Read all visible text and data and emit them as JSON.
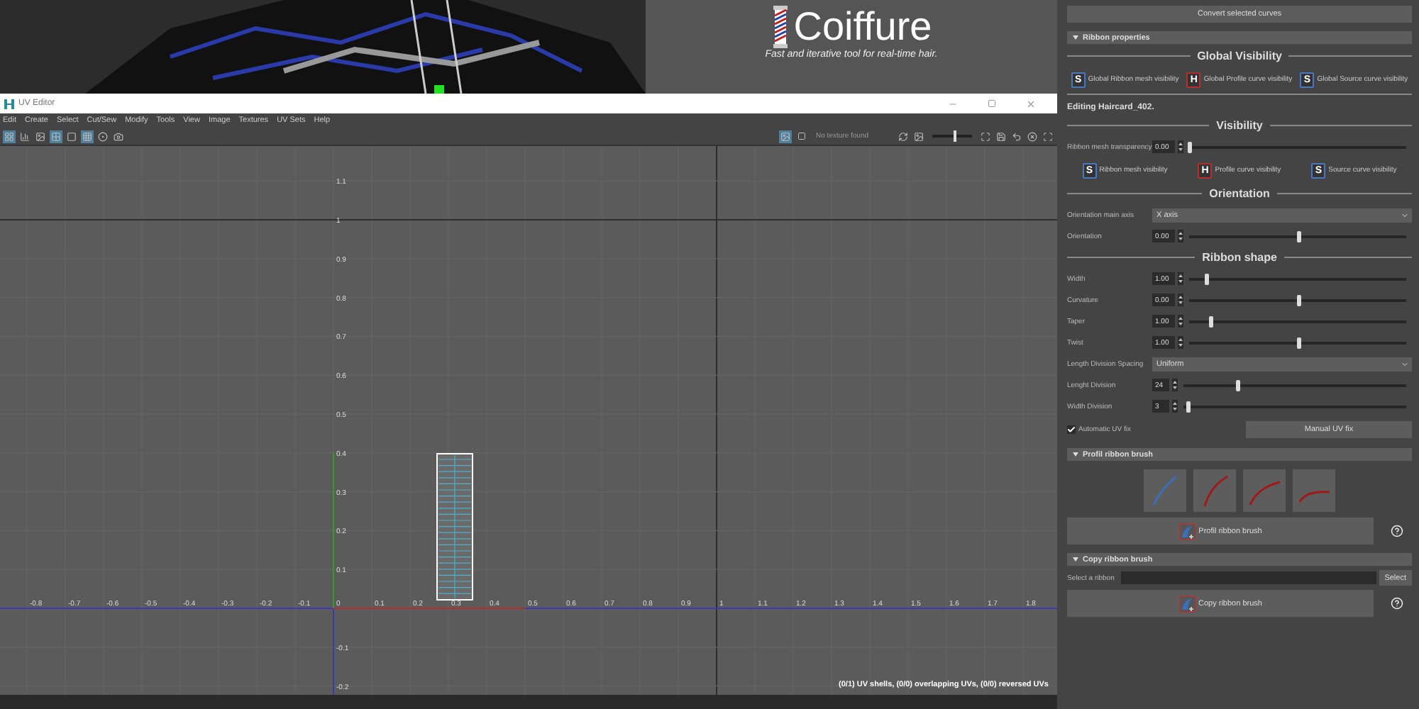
{
  "viewport": {
    "logo": {
      "name": "Coiffure",
      "tagline": "Fast and iterative tool for real-time hair."
    }
  },
  "uv_editor": {
    "title": "UV Editor",
    "menu": [
      "Edit",
      "Create",
      "Select",
      "Cut/Sew",
      "Modify",
      "Tools",
      "View",
      "Image",
      "Textures",
      "UV Sets",
      "Help"
    ],
    "toolbar_left": [
      {
        "selected": true
      },
      {
        "selected": false
      },
      {
        "selected": false
      },
      {
        "selected": true
      },
      {
        "selected": false
      },
      {
        "selected": true
      },
      {
        "selected": false
      },
      {
        "selected": false
      }
    ],
    "toolbar_right": {
      "texture_toggle": {
        "selected": true
      },
      "texture_status": "No texture found",
      "exposure": {
        "level": 0.55
      }
    },
    "x_ticks_negative": [
      "-0.8",
      "-0.7",
      "-0.6",
      "-0.5",
      "-0.4",
      "-0.3",
      "-0.2",
      "-0.1"
    ],
    "x_ticks": [
      "0",
      "0.1",
      "0.2",
      "0.3",
      "0.4",
      "0.5",
      "0.6",
      "0.7",
      "0.8",
      "0.9",
      "1",
      "1.1",
      "1.2",
      "1.3",
      "1.4",
      "1.5",
      "1.6",
      "1.7",
      "1.8"
    ],
    "y_ticks_positive": [
      "1.1",
      "1",
      "0.9",
      "0.8",
      "0.7",
      "0.6",
      "0.5",
      "0.4",
      "0.3",
      "0.2",
      "0.1"
    ],
    "y_ticks_negative": [
      "-0.1",
      "-0.2"
    ],
    "status": "(0/1) UV shells, (0/0) overlapping UVs, (0/0) reversed UVs"
  },
  "panel": {
    "convert_button": "Convert selected curves",
    "ribbon_properties": {
      "header": "Ribbon properties",
      "expanded": true,
      "global_visibility": {
        "title": "Global Visibility",
        "toggles": [
          {
            "letter": "S",
            "label": "Global Ribbon mesh visibility",
            "color": "#4a78c0"
          },
          {
            "letter": "H",
            "label": "Global Profile curve visibility",
            "color": "#b03030"
          },
          {
            "letter": "S",
            "label": "Global Source curve visibility",
            "color": "#4a78c0"
          }
        ]
      },
      "editing": "Editing Haircard_402.",
      "visibility": {
        "title": "Visibility",
        "transparency": {
          "label": "Ribbon mesh transparency",
          "value": "0.00",
          "level": 0
        },
        "toggles": [
          {
            "letter": "S",
            "label": "Ribbon mesh visibility",
            "color": "#4a78c0"
          },
          {
            "letter": "H",
            "label": "Profile curve visibility",
            "color": "#b03030"
          },
          {
            "letter": "S",
            "label": "Source curve visibility",
            "color": "#4a78c0"
          }
        ]
      },
      "orientation": {
        "title": "Orientation",
        "main_axis": {
          "label": "Orientation main axis",
          "value": "X axis"
        },
        "orientation": {
          "label": "Orientation",
          "value": "0.00",
          "level": 0.5
        }
      },
      "ribbon_shape": {
        "title": "Ribbon shape",
        "sliders": [
          {
            "label": "Width",
            "value": "1.00",
            "level": 0.08
          },
          {
            "label": "Curvature",
            "value": "0.00",
            "level": 0.5
          },
          {
            "label": "Taper",
            "value": "1.00",
            "level": 0.1
          },
          {
            "label": "Twist",
            "value": "1.00",
            "level": 0.5
          }
        ],
        "spacing": {
          "label": "Length Division Spacing",
          "value": "Uniform"
        },
        "divisions": [
          {
            "label": "Lenght Division",
            "value": "24",
            "level": 0.24
          },
          {
            "label": "Width Division",
            "value": "3",
            "level": 0.02
          }
        ],
        "automatic_uv_fix": {
          "label": "Automatic UV fix",
          "checked": true
        },
        "manual_uv_fix": "Manual UV fix"
      }
    },
    "profil_ribbon_brush": {
      "header": "Profil ribbon brush",
      "expanded": true,
      "curves": [
        {
          "kind": "straight",
          "color": "#3d6fb8"
        },
        {
          "kind": "arc",
          "color": "#a01818"
        },
        {
          "kind": "bend",
          "color": "#a01818"
        },
        {
          "kind": "flat",
          "color": "#a01818"
        }
      ],
      "button": "Profil ribbon brush"
    },
    "copy_ribbon_brush": {
      "header": "Copy ribbon brush",
      "expanded": true,
      "select_label": "Select a ribbon",
      "select_button": "Select",
      "button": "Copy ribbon brush"
    }
  }
}
